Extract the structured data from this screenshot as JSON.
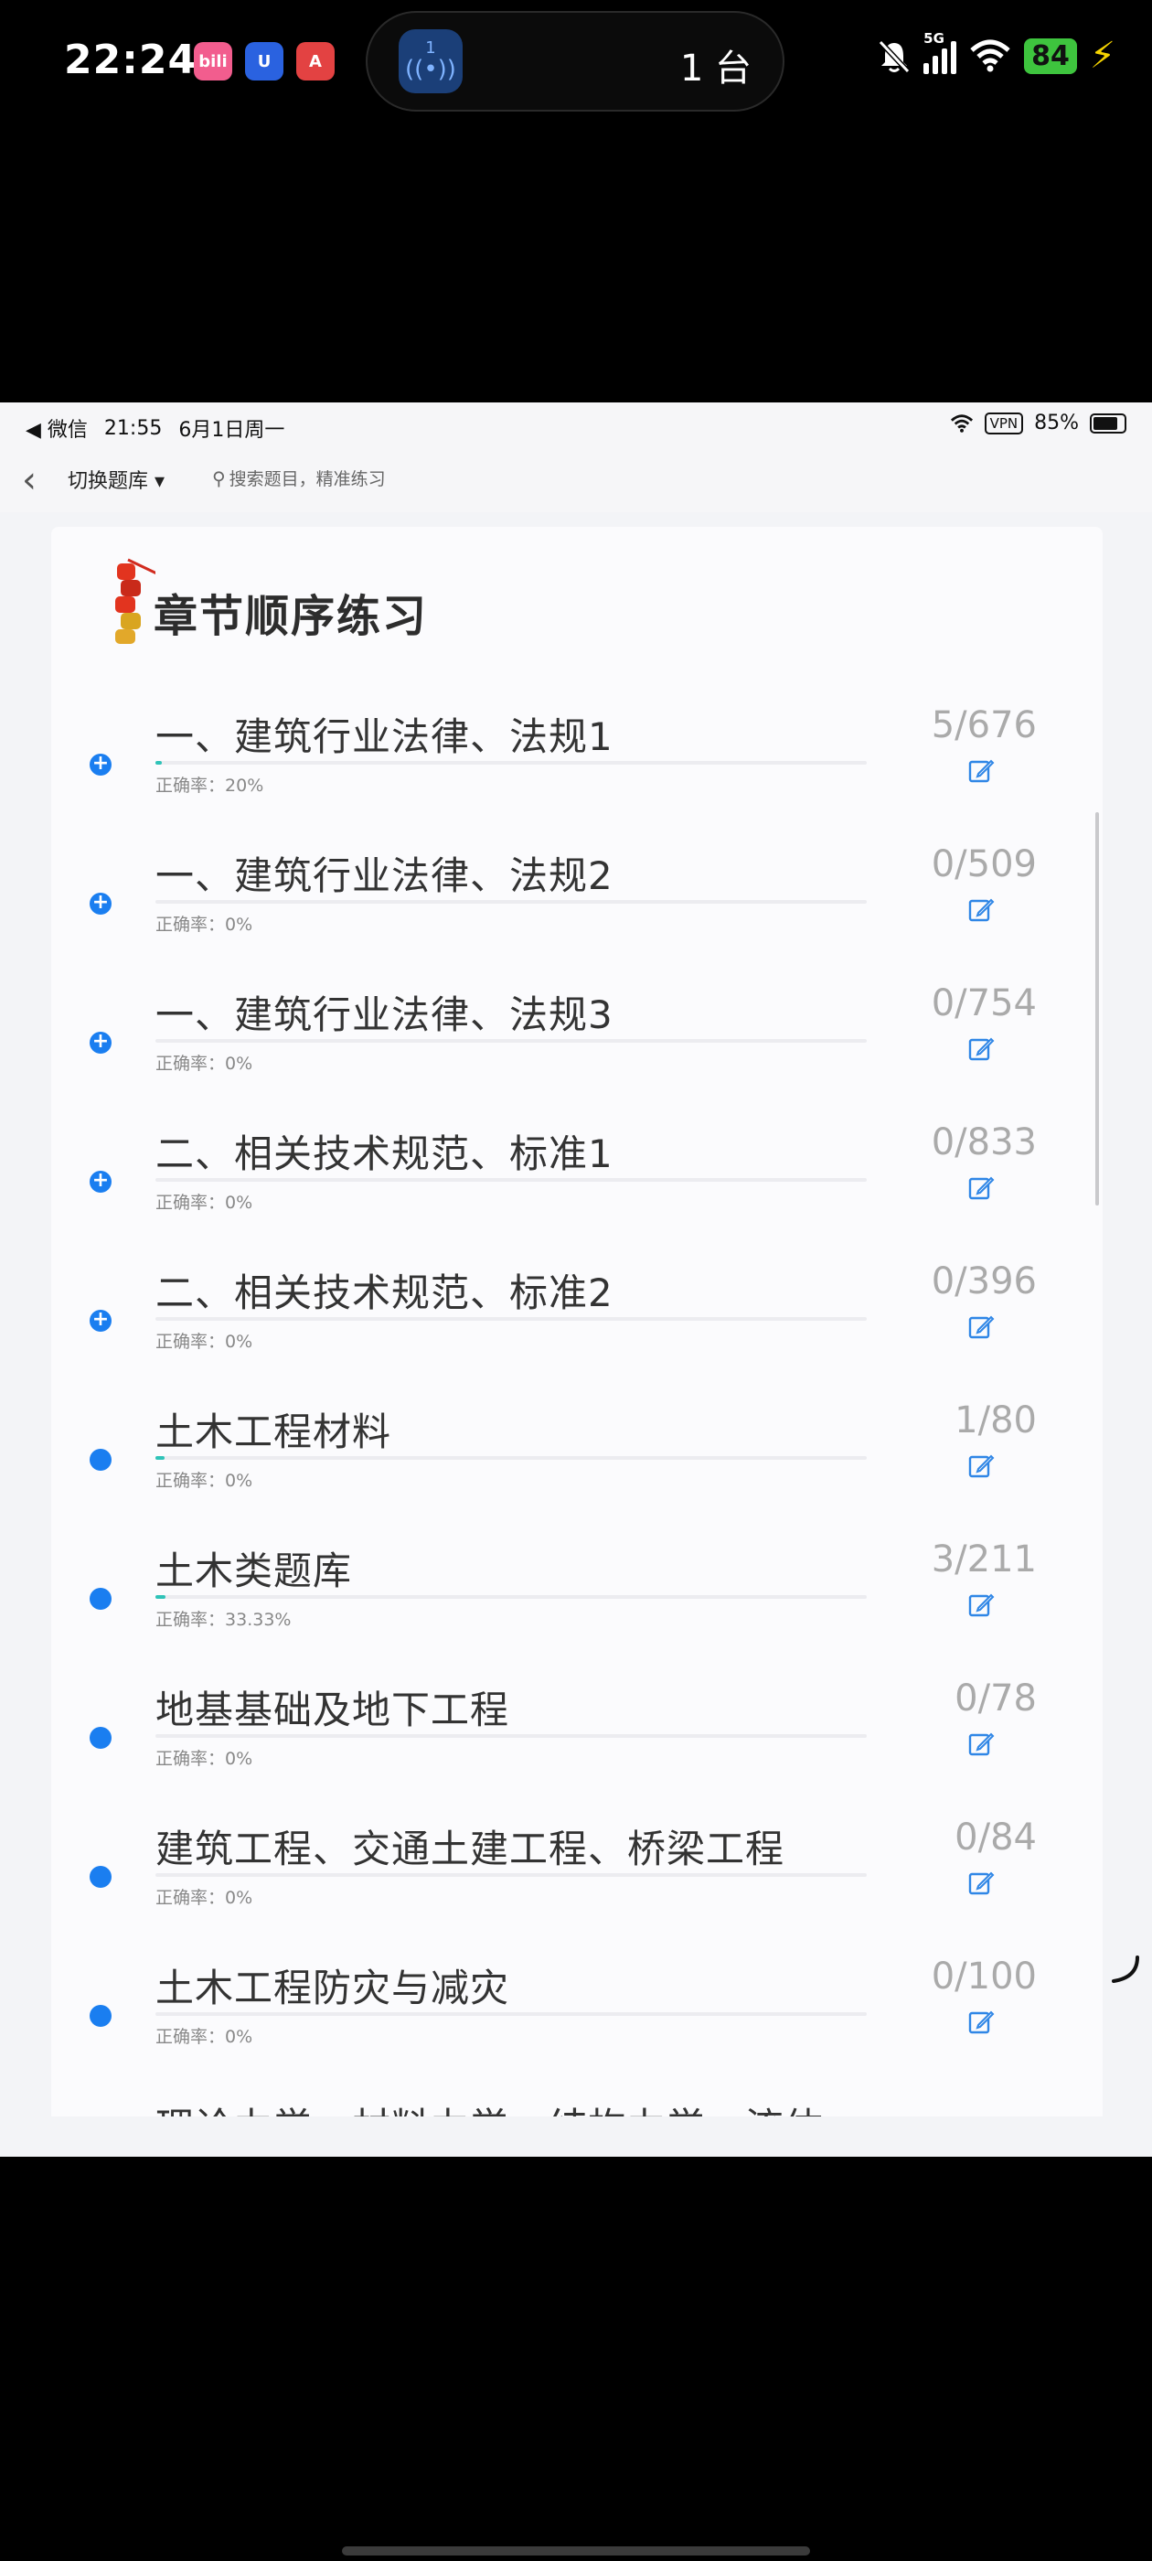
{
  "phone_status": {
    "time": "22:24",
    "app_icons": [
      {
        "name": "bilibili-icon",
        "text": "bili",
        "color": "#f25d8e"
      },
      {
        "name": "shield-app-icon",
        "text": "U",
        "color": "#2a62e0"
      },
      {
        "name": "red-a-app-icon",
        "text": "A",
        "color": "#e34242"
      }
    ],
    "island_count": "1",
    "island_text": "1 台",
    "network": "5G",
    "battery": "84"
  },
  "inner_status": {
    "back_app": "◀ 微信",
    "time": "21:55",
    "date": "6月1日周一",
    "vpn": "VPN",
    "battery": "85%"
  },
  "nav": {
    "switch_label": "切换题库",
    "search_placeholder": "搜索题目，精准练习"
  },
  "section_title": "章节顺序练习",
  "accuracy_label": "正确率：",
  "chapters": [
    {
      "title": "一、建筑行业法律、法规1",
      "count": "5/676",
      "accuracy": "20%",
      "progress": 0.0074,
      "marker": "plus"
    },
    {
      "title": "一、建筑行业法律、法规2",
      "count": "0/509",
      "accuracy": "0%",
      "progress": 0,
      "marker": "plus"
    },
    {
      "title": "一、建筑行业法律、法规3",
      "count": "0/754",
      "accuracy": "0%",
      "progress": 0,
      "marker": "plus"
    },
    {
      "title": "二、相关技术规范、标准1",
      "count": "0/833",
      "accuracy": "0%",
      "progress": 0,
      "marker": "plus"
    },
    {
      "title": "二、相关技术规范、标准2",
      "count": "0/396",
      "accuracy": "0%",
      "progress": 0,
      "marker": "plus"
    },
    {
      "title": "土木工程材料",
      "count": "1/80",
      "accuracy": "0%",
      "progress": 0.0125,
      "marker": "dot"
    },
    {
      "title": "土木类题库",
      "count": "3/211",
      "accuracy": "33.33%",
      "progress": 0.0142,
      "marker": "dot"
    },
    {
      "title": "地基基础及地下工程",
      "count": "0/78",
      "accuracy": "0%",
      "progress": 0,
      "marker": "dot"
    },
    {
      "title": "建筑工程、交通土建工程、桥梁工程",
      "count": "0/84",
      "accuracy": "0%",
      "progress": 0,
      "marker": "dot"
    },
    {
      "title": "土木工程防灾与减灾",
      "count": "0/100",
      "accuracy": "0%",
      "progress": 0,
      "marker": "dot"
    },
    {
      "title": "理论力学、材料力学、结构力学、流体",
      "count": "",
      "accuracy": "",
      "progress": 0,
      "marker": "none"
    }
  ]
}
